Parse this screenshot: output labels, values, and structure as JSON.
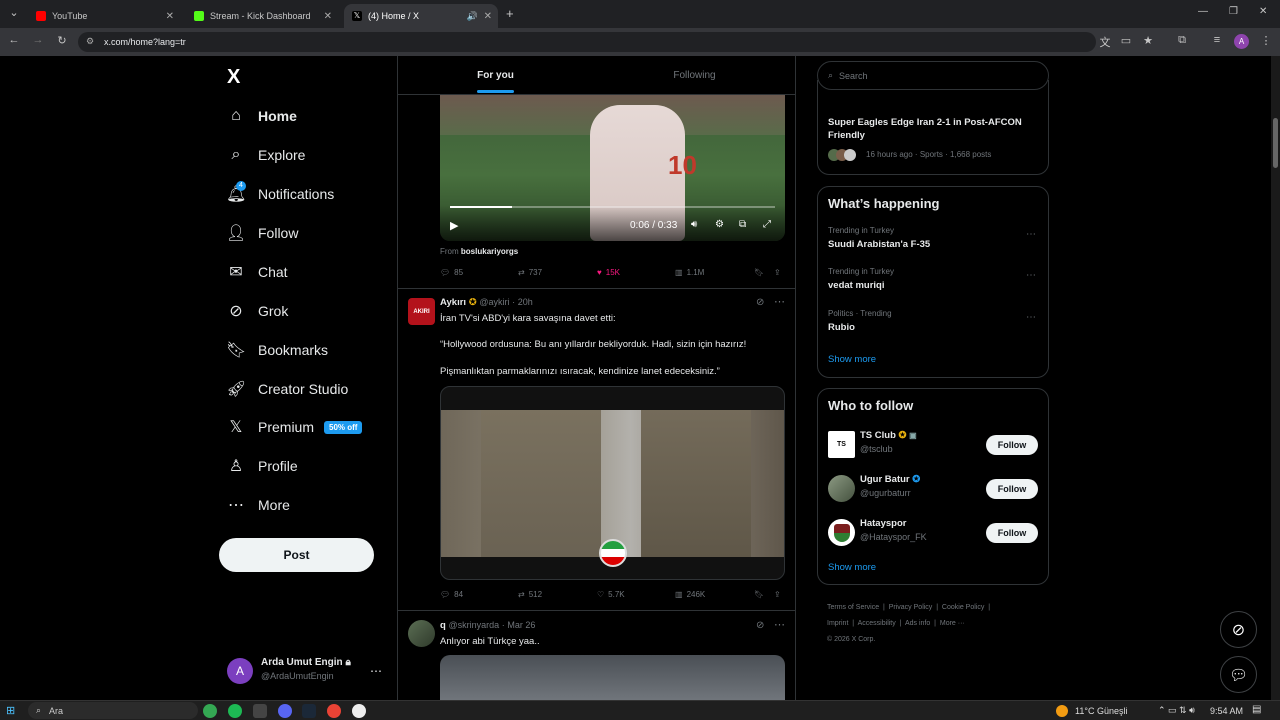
{
  "browser": {
    "tabs": [
      {
        "title": "YouTube",
        "color": "#ff0000"
      },
      {
        "title": "Stream - Kick Dashboard",
        "color": "#53fc18"
      },
      {
        "title": "(4) Home / X",
        "color": "#e7e9ea"
      }
    ],
    "new_tab": "+",
    "url": "x.com/home?lang=tr",
    "profile_initial": "A"
  },
  "nav": {
    "logo": "X",
    "items": [
      {
        "label": "Home",
        "icon": "home-icon"
      },
      {
        "label": "Explore",
        "icon": "search-icon"
      },
      {
        "label": "Notifications",
        "icon": "bell-icon",
        "badge": "4"
      },
      {
        "label": "Follow",
        "icon": "add-person-icon"
      },
      {
        "label": "Chat",
        "icon": "mail-icon"
      },
      {
        "label": "Grok",
        "icon": "grok-icon"
      },
      {
        "label": "Bookmarks",
        "icon": "bookmark-icon"
      },
      {
        "label": "Creator Studio",
        "icon": "rocket-icon"
      },
      {
        "label": "Premium",
        "icon": "x-icon",
        "badge": "50% off"
      },
      {
        "label": "Profile",
        "icon": "person-icon"
      },
      {
        "label": "More",
        "icon": "more-icon"
      }
    ],
    "post_label": "Post",
    "account": {
      "initial": "A",
      "name": "Arda Umut Engin",
      "handle": "@ArdaUmutEngin"
    }
  },
  "timeline": {
    "tabs": [
      "For you",
      "Following"
    ],
    "video1": {
      "time": "0:06 / 0:33",
      "progress": 0.19,
      "from_label": "From",
      "from_user": "boslukariyorgs"
    },
    "tweet1_actions": {
      "replies": "85",
      "retweets": "737",
      "likes": "15K",
      "views": "1.1M"
    },
    "tweet2": {
      "name": "Aykırı",
      "handle": "@aykiri",
      "time": "20h",
      "avatar_text": "AKIRI",
      "line1": "İran TV'si ABD'yi kara savaşına davet etti:",
      "line2": "“Hollywood ordusuna: Bu anı yıllardır bekliyorduk. Hadi, sizin için hazırız!",
      "line3": "Pişmanlıktan parmaklarınızı ısıracak, kendinize lanet edeceksiniz.”",
      "replies": "84",
      "retweets": "512",
      "likes": "5.7K",
      "views": "246K"
    },
    "tweet3": {
      "name": "q",
      "handle": "@skrinyarda",
      "time": "Mar 26",
      "text": "Anlıyor abi Türkçe yaa.."
    }
  },
  "right": {
    "search_placeholder": "Search",
    "news": {
      "title": "Super Eagles Edge Iran 2-1 in Post-AFCON Friendly",
      "meta": "16 hours ago · Sports · 1,668 posts"
    },
    "happening_title": "What’s happening",
    "trends": [
      {
        "context": "Trending in Turkey",
        "name": "Suudi Arabistan'a F-35"
      },
      {
        "context": "Trending in Turkey",
        "name": "vedat muriqi"
      },
      {
        "context": "Politics · Trending",
        "name": "Rubio"
      }
    ],
    "show_more": "Show more",
    "who_title": "Who to follow",
    "who": [
      {
        "name": "TS Club",
        "handle": "@tsclub",
        "avatar": "TS"
      },
      {
        "name": "Ugur Batur",
        "handle": "@ugurbaturr",
        "avatar": ""
      },
      {
        "name": "Hatayspor",
        "handle": "@Hatayspor_FK",
        "avatar": ""
      }
    ],
    "follow_label": "Follow",
    "footer": [
      "Terms of Service",
      "Privacy Policy",
      "Cookie Policy",
      "Imprint",
      "Accessibility",
      "Ads info",
      "More ···",
      "© 2026 X Corp."
    ]
  },
  "taskbar": {
    "search": "Ara",
    "weather": "11°C  Güneşli",
    "time": "9:54 AM"
  }
}
